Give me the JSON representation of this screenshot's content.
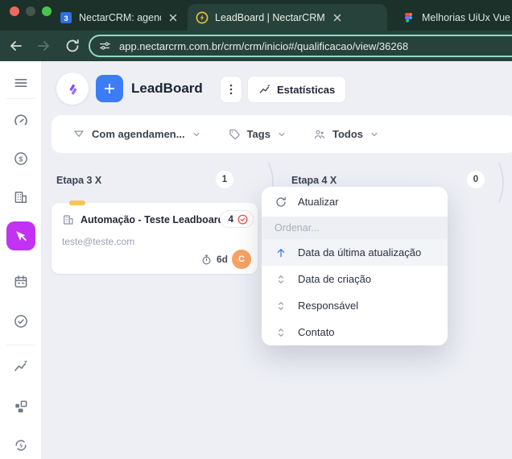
{
  "browser": {
    "tabs": [
      {
        "title": "NectarCRM: agenda - S",
        "icon": "google-calendar-icon"
      },
      {
        "title": "LeadBoard | NectarCRM",
        "icon": "nectarcrm-favicon"
      },
      {
        "title": "Melhorias UiUx Vue",
        "icon": "figma-icon"
      }
    ],
    "url": "app.nectarcrm.com.br/crm/crm/inicio#/qualificacao/view/36268"
  },
  "sidebar": {
    "icons": [
      "menu",
      "dashboard-gauge",
      "sales-dollar",
      "companies-building",
      "leads-funnel-active",
      "calendar",
      "tasks-check",
      "statistics-trend",
      "apps-blocks",
      "automation-sync"
    ]
  },
  "header": {
    "title": "LeadBoard",
    "stats_label": "Estatísticas"
  },
  "filters": {
    "scheduling": "Com agendamen...",
    "tags": "Tags",
    "owner": "Todos"
  },
  "board": {
    "columns": [
      {
        "name": "Etapa 3 X",
        "count": "1"
      },
      {
        "name": "Etapa 4 X",
        "count": "0"
      }
    ],
    "card": {
      "title": "Automação - Teste Leadboard",
      "email": "teste@teste.com",
      "badge_count": "4",
      "age": "6d",
      "avatar_initial": "C"
    }
  },
  "menu": {
    "refresh": "Atualizar",
    "section_label": "Ordenar...",
    "items": [
      {
        "label": "Data da última atualização",
        "active": true
      },
      {
        "label": "Data de criação",
        "active": false
      },
      {
        "label": "Responsável",
        "active": false
      },
      {
        "label": "Contato",
        "active": false
      }
    ]
  },
  "colors": {
    "chrome_dark": "#1b312a",
    "chrome_active": "#27423a",
    "omnibox_teal": "#90dcc5",
    "accent_purple": "#c232f2",
    "accent_blue": "#3c7df7",
    "logo_purple": "#7a4ff5",
    "avatar_orange": "#f8a264",
    "badge_red": "#ef4a4a",
    "tag_yellow": "#f6c64f",
    "board_bg": "#edeff5"
  }
}
